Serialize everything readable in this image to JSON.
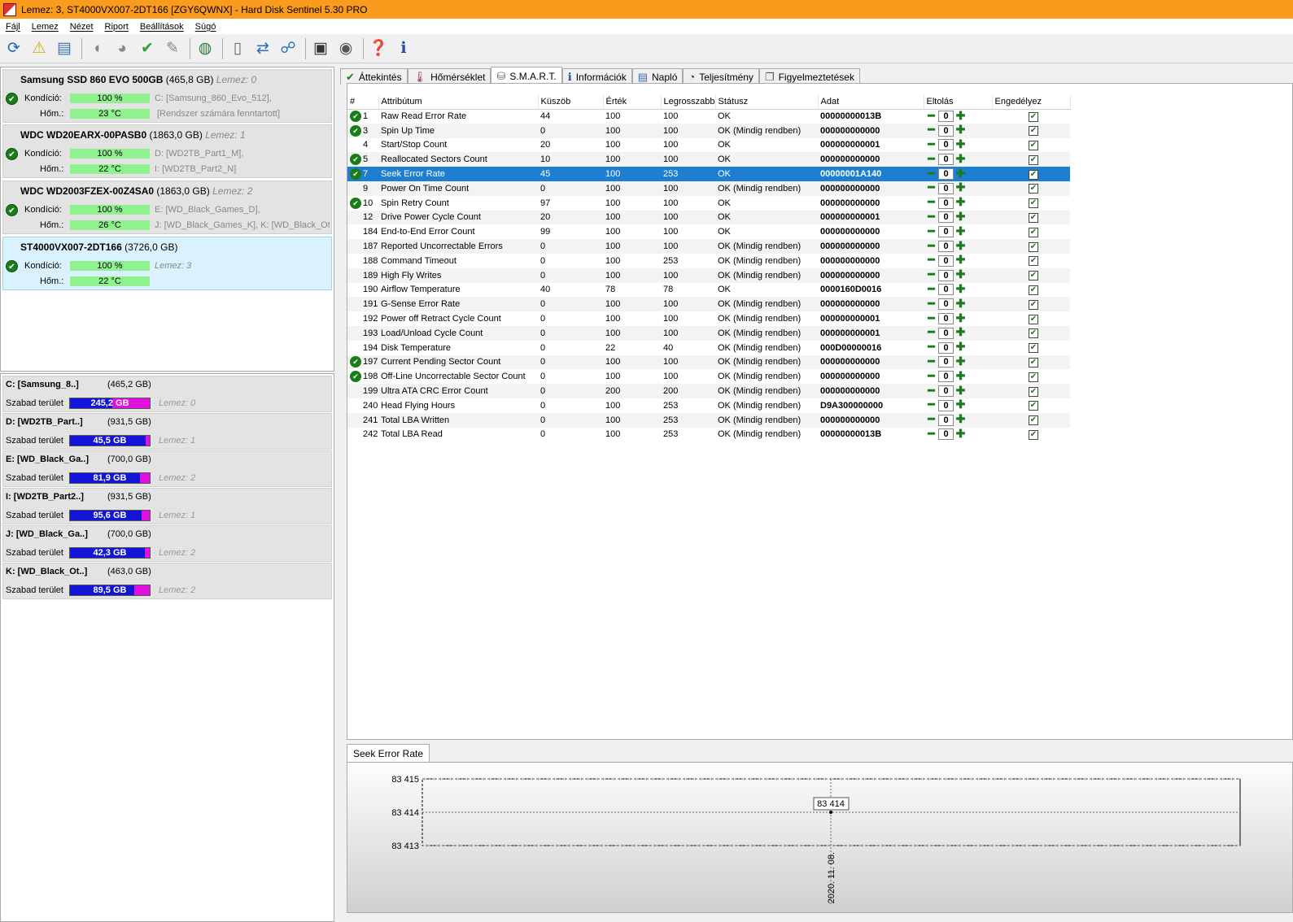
{
  "window": {
    "title": "Lemez: 3, ST4000VX007-2DT166 [ZGY6QWNX]  -  Hard Disk Sentinel 5.30 PRO"
  },
  "menu": [
    "Fájl",
    "Lemez",
    "Nézet",
    "Riport",
    "Beállítások",
    "Súgó"
  ],
  "disks": [
    {
      "name": "Samsung SSD 860 EVO 500GB",
      "size": "(465,8 GB)",
      "lemez": "Lemez: 0",
      "kond_label": "Kondíció:",
      "kond": "100 %",
      "hom_label": "Hőm.:",
      "hom": "23 °C",
      "line1": "C: [Samsung_860_Evo_512],",
      "line2": "[Rendszer számára fenntartott]"
    },
    {
      "name": "WDC WD20EARX-00PASB0",
      "size": "(1863,0 GB)",
      "lemez": "Lemez: 1",
      "kond_label": "Kondíció:",
      "kond": "100 %",
      "hom_label": "Hőm.:",
      "hom": "22 °C",
      "line1": "D: [WD2TB_Part1_M],",
      "line2": "I: [WD2TB_Part2_N]"
    },
    {
      "name": "WDC WD2003FZEX-00Z4SA0",
      "size": "(1863,0 GB)",
      "lemez": "Lemez: 2",
      "kond_label": "Kondíció:",
      "kond": "100 %",
      "hom_label": "Hőm.:",
      "hom": "26 °C",
      "line1": "E: [WD_Black_Games_D],",
      "line2": "J: [WD_Black_Games_K], K: [WD_Black_Oth"
    },
    {
      "name": "ST4000VX007-2DT166",
      "size": "(3726,0 GB)",
      "lemez": "Lemez: 3",
      "kond_label": "Kondíció:",
      "kond": "100 %",
      "hom_label": "Hőm.:",
      "hom": "22 °C",
      "line1": "",
      "line2": ""
    }
  ],
  "partitions": [
    {
      "name": "C: [Samsung_8..]",
      "size": "(465,2 GB)",
      "free_label": "Szabad terület",
      "free": "245,2 GB",
      "fill": 0.53,
      "lemez": "Lemez: 0"
    },
    {
      "name": "D: [WD2TB_Part..]",
      "size": "(931,5 GB)",
      "free_label": "Szabad terület",
      "free": "45,5 GB",
      "fill": 0.95,
      "lemez": "Lemez: 1"
    },
    {
      "name": "E: [WD_Black_Ga..]",
      "size": "(700,0 GB)",
      "free_label": "Szabad terület",
      "free": "81,9 GB",
      "fill": 0.88,
      "lemez": "Lemez: 2"
    },
    {
      "name": "I: [WD2TB_Part2..]",
      "size": "(931,5 GB)",
      "free_label": "Szabad terület",
      "free": "95,6 GB",
      "fill": 0.9,
      "lemez": "Lemez: 1"
    },
    {
      "name": "J: [WD_Black_Ga..]",
      "size": "(700,0 GB)",
      "free_label": "Szabad terület",
      "free": "42,3 GB",
      "fill": 0.94,
      "lemez": "Lemez: 2"
    },
    {
      "name": "K: [WD_Black_Ot..]",
      "size": "(463,0 GB)",
      "free_label": "Szabad terület",
      "free": "89,5 GB",
      "fill": 0.81,
      "lemez": "Lemez: 2"
    }
  ],
  "tabs": [
    "Áttekintés",
    "Hőmérséklet",
    "S.M.A.R.T.",
    "Információk",
    "Napló",
    "Teljesítmény",
    "Figyelmeztetések"
  ],
  "columns": [
    "#",
    "Attribútum",
    "Küszöb",
    "Érték",
    "Legrosszabb",
    "Státusz",
    "Adat",
    "Eltolás",
    "Engedélyez"
  ],
  "rows": [
    {
      "ok": true,
      "id": "1",
      "attr": "Raw Read Error Rate",
      "thr": "44",
      "val": "100",
      "worst": "100",
      "status": "OK",
      "data": "00000000013B"
    },
    {
      "ok": true,
      "id": "3",
      "attr": "Spin Up Time",
      "thr": "0",
      "val": "100",
      "worst": "100",
      "status": "OK (Mindig rendben)",
      "data": "000000000000"
    },
    {
      "ok": false,
      "id": "4",
      "attr": "Start/Stop Count",
      "thr": "20",
      "val": "100",
      "worst": "100",
      "status": "OK",
      "data": "000000000001"
    },
    {
      "ok": true,
      "id": "5",
      "attr": "Reallocated Sectors Count",
      "thr": "10",
      "val": "100",
      "worst": "100",
      "status": "OK",
      "data": "000000000000"
    },
    {
      "ok": true,
      "id": "7",
      "attr": "Seek Error Rate",
      "thr": "45",
      "val": "100",
      "worst": "253",
      "status": "OK",
      "data": "00000001A140",
      "hl": true
    },
    {
      "ok": false,
      "id": "9",
      "attr": "Power On Time Count",
      "thr": "0",
      "val": "100",
      "worst": "100",
      "status": "OK (Mindig rendben)",
      "data": "000000000000"
    },
    {
      "ok": true,
      "id": "10",
      "attr": "Spin Retry Count",
      "thr": "97",
      "val": "100",
      "worst": "100",
      "status": "OK",
      "data": "000000000000"
    },
    {
      "ok": false,
      "id": "12",
      "attr": "Drive Power Cycle Count",
      "thr": "20",
      "val": "100",
      "worst": "100",
      "status": "OK",
      "data": "000000000001"
    },
    {
      "ok": false,
      "id": "184",
      "attr": "End-to-End Error Count",
      "thr": "99",
      "val": "100",
      "worst": "100",
      "status": "OK",
      "data": "000000000000"
    },
    {
      "ok": false,
      "id": "187",
      "attr": "Reported Uncorrectable Errors",
      "thr": "0",
      "val": "100",
      "worst": "100",
      "status": "OK (Mindig rendben)",
      "data": "000000000000"
    },
    {
      "ok": false,
      "id": "188",
      "attr": "Command Timeout",
      "thr": "0",
      "val": "100",
      "worst": "253",
      "status": "OK (Mindig rendben)",
      "data": "000000000000"
    },
    {
      "ok": false,
      "id": "189",
      "attr": "High Fly Writes",
      "thr": "0",
      "val": "100",
      "worst": "100",
      "status": "OK (Mindig rendben)",
      "data": "000000000000"
    },
    {
      "ok": false,
      "id": "190",
      "attr": "Airflow Temperature",
      "thr": "40",
      "val": "78",
      "worst": "78",
      "status": "OK",
      "data": "0000160D0016"
    },
    {
      "ok": false,
      "id": "191",
      "attr": "G-Sense Error Rate",
      "thr": "0",
      "val": "100",
      "worst": "100",
      "status": "OK (Mindig rendben)",
      "data": "000000000000"
    },
    {
      "ok": false,
      "id": "192",
      "attr": "Power off Retract Cycle Count",
      "thr": "0",
      "val": "100",
      "worst": "100",
      "status": "OK (Mindig rendben)",
      "data": "000000000001"
    },
    {
      "ok": false,
      "id": "193",
      "attr": "Load/Unload Cycle Count",
      "thr": "0",
      "val": "100",
      "worst": "100",
      "status": "OK (Mindig rendben)",
      "data": "000000000001"
    },
    {
      "ok": false,
      "id": "194",
      "attr": "Disk Temperature",
      "thr": "0",
      "val": "22",
      "worst": "40",
      "status": "OK (Mindig rendben)",
      "data": "000D00000016"
    },
    {
      "ok": true,
      "id": "197",
      "attr": "Current Pending Sector Count",
      "thr": "0",
      "val": "100",
      "worst": "100",
      "status": "OK (Mindig rendben)",
      "data": "000000000000"
    },
    {
      "ok": true,
      "id": "198",
      "attr": "Off-Line Uncorrectable Sector Count",
      "thr": "0",
      "val": "100",
      "worst": "100",
      "status": "OK (Mindig rendben)",
      "data": "000000000000"
    },
    {
      "ok": false,
      "id": "199",
      "attr": "Ultra ATA CRC Error Count",
      "thr": "0",
      "val": "200",
      "worst": "200",
      "status": "OK (Mindig rendben)",
      "data": "000000000000"
    },
    {
      "ok": false,
      "id": "240",
      "attr": "Head Flying Hours",
      "thr": "0",
      "val": "100",
      "worst": "253",
      "status": "OK (Mindig rendben)",
      "data": "D9A300000000"
    },
    {
      "ok": false,
      "id": "241",
      "attr": "Total LBA Written",
      "thr": "0",
      "val": "100",
      "worst": "253",
      "status": "OK (Mindig rendben)",
      "data": "000000000000"
    },
    {
      "ok": false,
      "id": "242",
      "attr": "Total LBA Read",
      "thr": "0",
      "val": "100",
      "worst": "253",
      "status": "OK (Mindig rendben)",
      "data": "00000000013B"
    }
  ],
  "offset_value": "0",
  "graph": {
    "tab": "Seek Error Rate",
    "chart_data": {
      "type": "line",
      "x": [
        "2020. 11. 08."
      ],
      "values": [
        83414
      ],
      "point_label": "83 414",
      "yticks": [
        "83 415",
        "83 414",
        "83 413"
      ],
      "ylim": [
        83413,
        83415
      ],
      "grid": true
    }
  }
}
